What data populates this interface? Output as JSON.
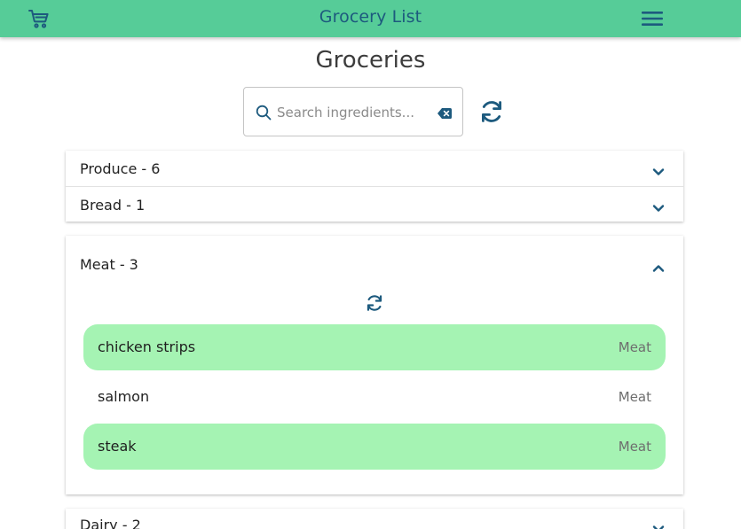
{
  "colors": {
    "accent": "#56cc98",
    "title": "#1d5a7e",
    "selected_row": "#a5f3b3"
  },
  "header": {
    "title": "Grocery List",
    "cart_icon": "cart-icon",
    "menu_icon": "hamburger-menu-icon"
  },
  "page": {
    "title": "Groceries"
  },
  "search": {
    "placeholder": "Search ingredients...",
    "value": "",
    "search_icon": "search-icon",
    "clear_icon": "backspace-clear-icon",
    "refresh_icon": "refresh-icon"
  },
  "categories": [
    {
      "label": "Produce - 6",
      "expanded": false
    },
    {
      "label": "Bread - 1",
      "expanded": false
    },
    {
      "label": "Meat - 3",
      "expanded": true,
      "items": [
        {
          "name": "chicken strips",
          "category": "Meat",
          "selected": true
        },
        {
          "name": "salmon",
          "category": "Meat",
          "selected": false
        },
        {
          "name": "steak",
          "category": "Meat",
          "selected": true
        }
      ]
    },
    {
      "label": "Dairy - 2",
      "expanded": false
    }
  ]
}
